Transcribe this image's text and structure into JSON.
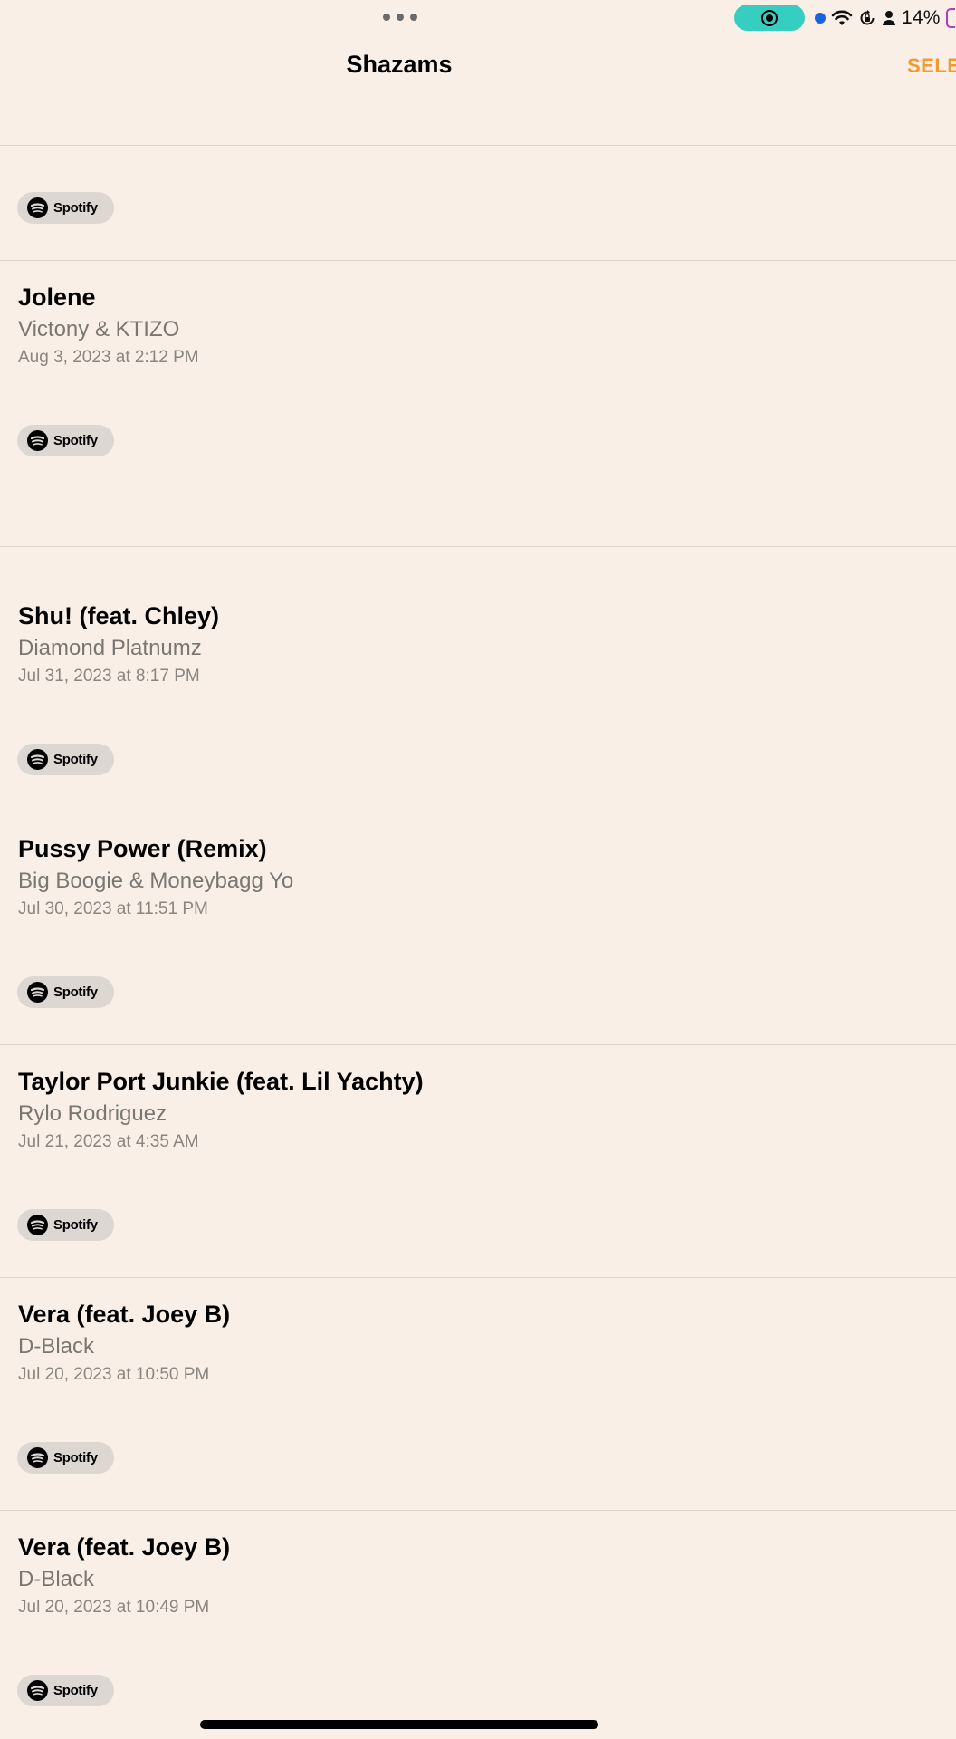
{
  "status_bar": {
    "battery": "14%",
    "icons": [
      "screen-record-icon",
      "location-dot",
      "wifi-icon",
      "orientation-lock-icon",
      "person-icon",
      "battery-icon"
    ]
  },
  "header": {
    "title": "Shazams",
    "select_label": "SELE"
  },
  "spotify_label": "Spotify",
  "songs": [
    {
      "title": "Jolene",
      "artist": "Victony & KTIZO",
      "date": "Aug 3, 2023 at 2:12 PM"
    },
    {
      "title": "Shu! (feat. Chley)",
      "artist": "Diamond Platnumz",
      "date": "Jul 31, 2023 at 8:17 PM"
    },
    {
      "title": "Pussy Power (Remix)",
      "artist": "Big Boogie & Moneybagg Yo",
      "date": "Jul 30, 2023 at 11:51 PM"
    },
    {
      "title": "Taylor Port Junkie (feat. Lil Yachty)",
      "artist": "Rylo Rodriguez",
      "date": "Jul 21, 2023 at 4:35 AM"
    },
    {
      "title": "Vera (feat. Joey B)",
      "artist": "D-Black",
      "date": "Jul 20, 2023 at 10:50 PM"
    },
    {
      "title": "Vera (feat. Joey B)",
      "artist": "D-Black",
      "date": "Jul 20, 2023 at 10:49 PM"
    }
  ],
  "colors": {
    "background": "#f9efe6",
    "accent": "#f29a2e",
    "record_pill": "#35cec0"
  }
}
